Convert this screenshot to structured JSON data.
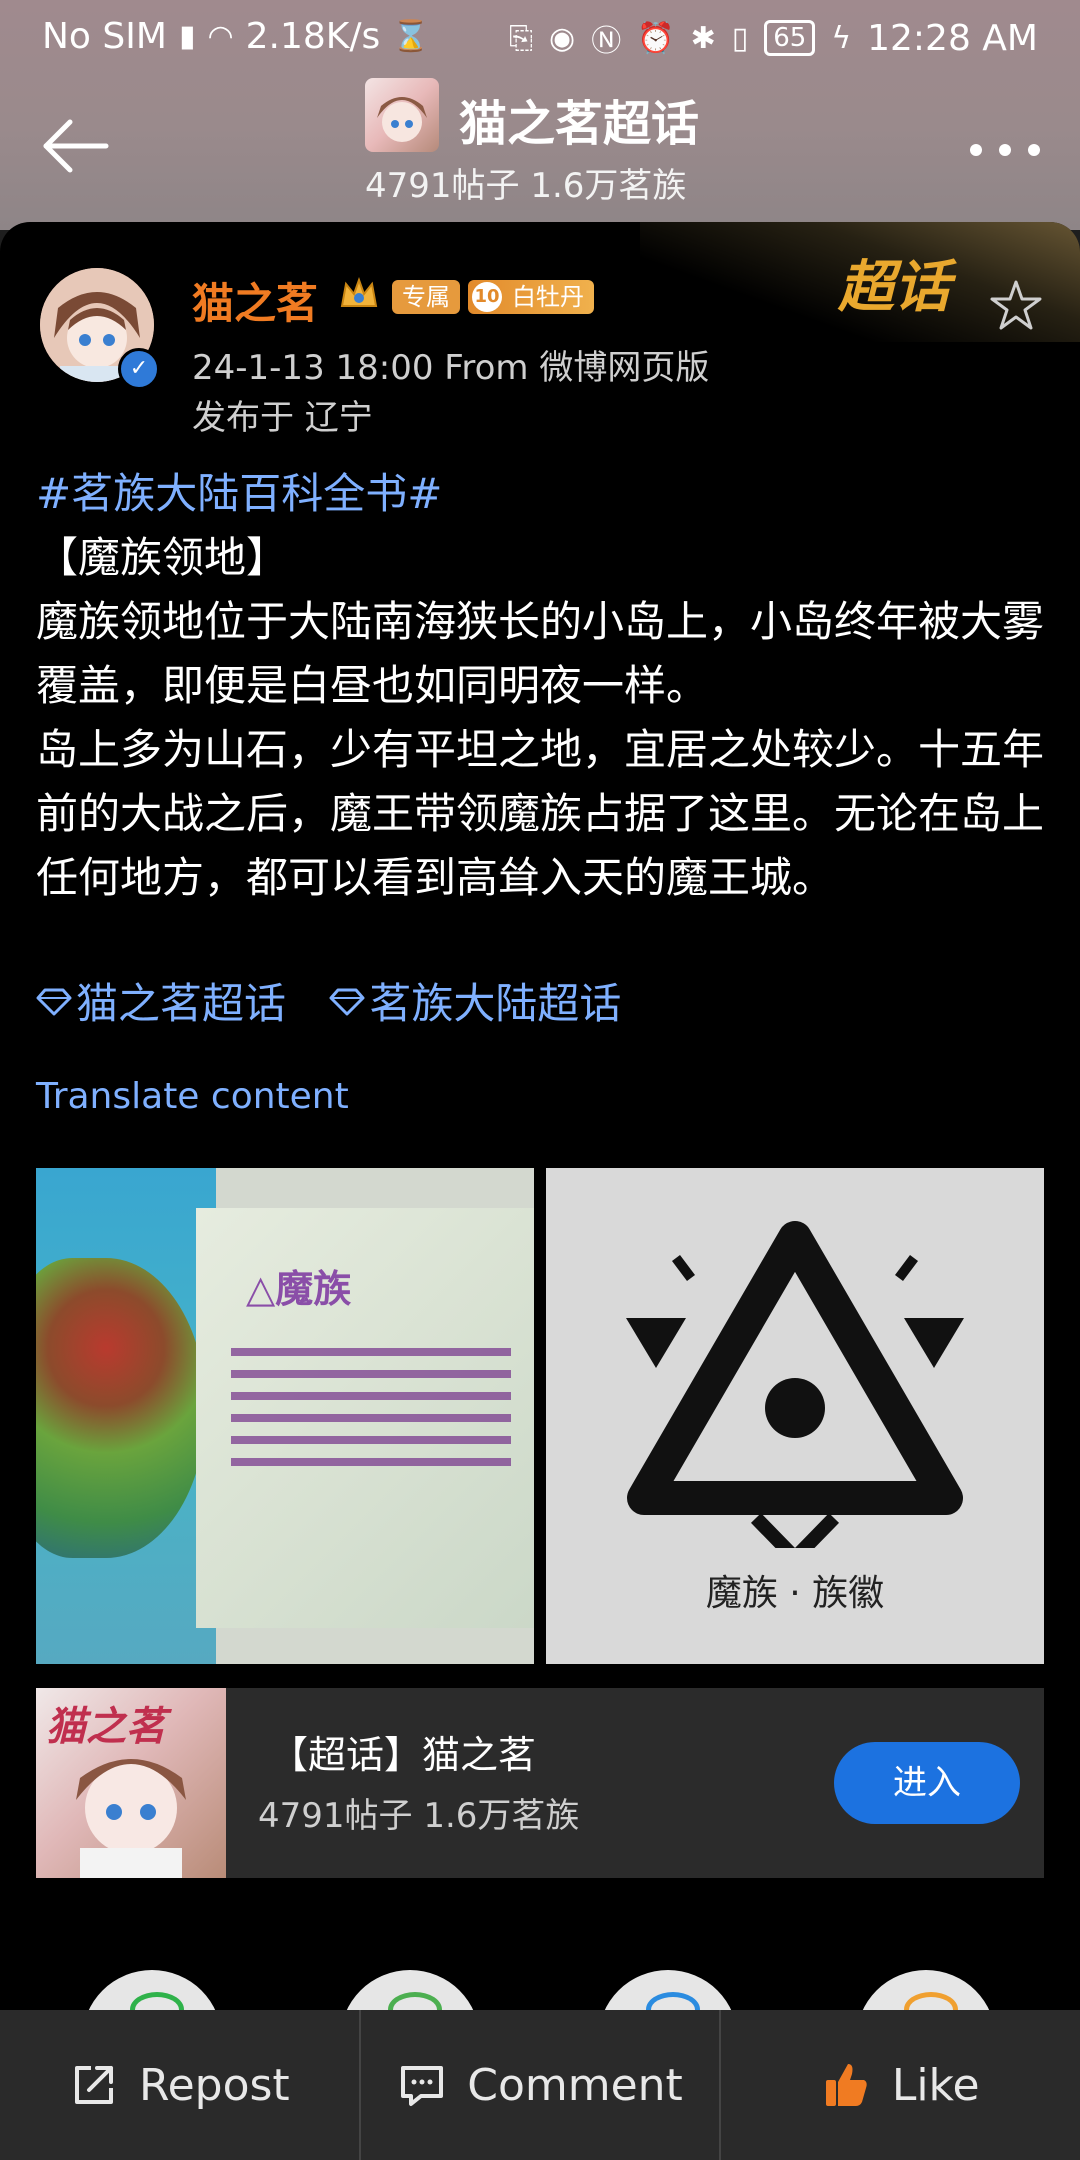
{
  "status_bar": {
    "carrier": "No SIM",
    "speed": "2.18K/s",
    "battery": "65",
    "time": "12:28 AM"
  },
  "header": {
    "title": "猫之茗超话",
    "subtitle": "4791帖子 1.6万茗族"
  },
  "badge_corner": {
    "label": "超话"
  },
  "post": {
    "author": "猫之茗",
    "chip_exclusive": "专属",
    "level": "10",
    "level_label": "白牡丹",
    "meta": "24-1-13 18:00  From 微博网页版",
    "location": "发布于 辽宁",
    "hashtag": "#茗族大陆百科全书#",
    "heading": "【魔族领地】",
    "paragraph1": "魔族领地位于大陆南海狭长的小岛上，小岛终年被大雾覆盖，即便是白昼也如同明夜一样。",
    "paragraph2": "岛上多为山石，少有平坦之地，宜居之处较少。十五年前的大战之后，魔王带领魔族占据了这里。无论在岛上任何地方，都可以看到高耸入天的魔王城。",
    "topic1": "猫之茗超话",
    "topic2": "茗族大陆超话",
    "translate": "Translate content"
  },
  "images": {
    "image1_title": "魔族",
    "image2_caption": "魔族 · 族徽"
  },
  "super_card": {
    "logo_text": "猫之茗",
    "title": "【超话】猫之茗",
    "subtitle": "4791帖子 1.6万茗族",
    "enter": "进入"
  },
  "bottom_bar": {
    "repost": "Repost",
    "comment": "Comment",
    "like": "Like"
  },
  "colors": {
    "accent_blue": "#7fb0ff",
    "author_orange": "#f07b22",
    "button_blue": "#1c72e0"
  }
}
